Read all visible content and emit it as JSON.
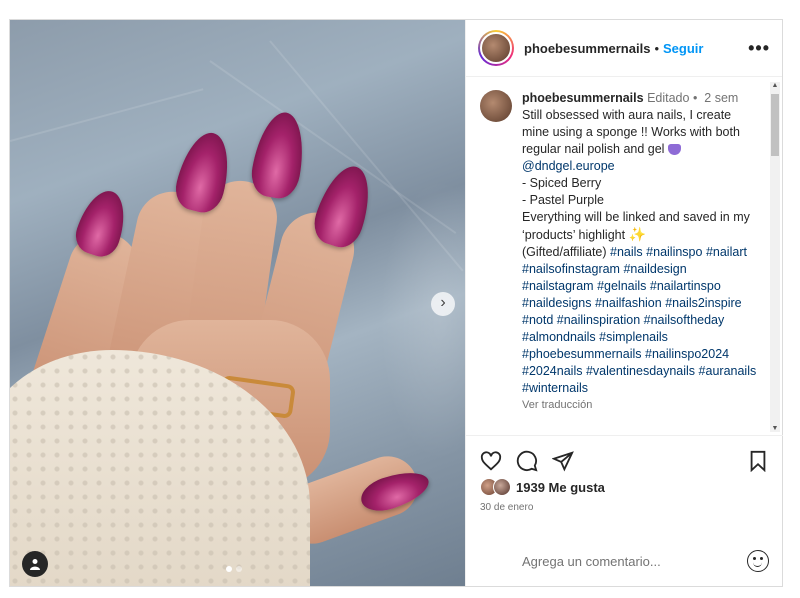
{
  "header": {
    "username": "phoebesummernails",
    "separator": "•",
    "follow_label": "Seguir",
    "more_icon": "more-horizontal-icon"
  },
  "caption": {
    "username": "phoebesummernails",
    "edited": "Editado",
    "dot": "•",
    "age": "2 sem",
    "lines": [
      "Still obsessed with aura nails, I create mine using a sponge !! Works with both regular nail polish and gel",
      "@dndgel.europe",
      "- Spiced Berry",
      "- Pastel Purple",
      "Everything will be linked and saved in my ‘products’ highlight",
      "(Gifted/affiliate)"
    ],
    "hashtags": [
      "#nails",
      "#nailinspo",
      "#nailart",
      "#nailsofinstagram",
      "#naildesign",
      "#nailstagram",
      "#gelnails",
      "#nailartinspo",
      "#naildesigns",
      "#nailfashion",
      "#nails2inspire",
      "#notd",
      "#nailinspiration",
      "#nailsoftheday",
      "#almondnails",
      "#simplenails",
      "#phoebesummernails",
      "#nailinspo2024",
      "#2024nails",
      "#valentinesdaynails",
      "#auranails",
      "#winternails"
    ],
    "see_translation": "Ver traducción"
  },
  "media": {
    "next_icon": "chevron-right-icon",
    "user_tag_icon": "person-icon",
    "carousel_count": 2,
    "carousel_active": 1
  },
  "actions": {
    "like_icon": "heart-icon",
    "comment_icon": "comment-icon",
    "share_icon": "send-icon",
    "save_icon": "bookmark-icon",
    "likes_count": "1939",
    "likes_label": "Me gusta",
    "date": "30 de enero"
  },
  "comment": {
    "placeholder": "Agrega un comentario...",
    "emoji_icon": "emoji-icon"
  },
  "colors": {
    "follow": "#0095f6",
    "hashtag": "#00376b",
    "muted": "#737373"
  }
}
